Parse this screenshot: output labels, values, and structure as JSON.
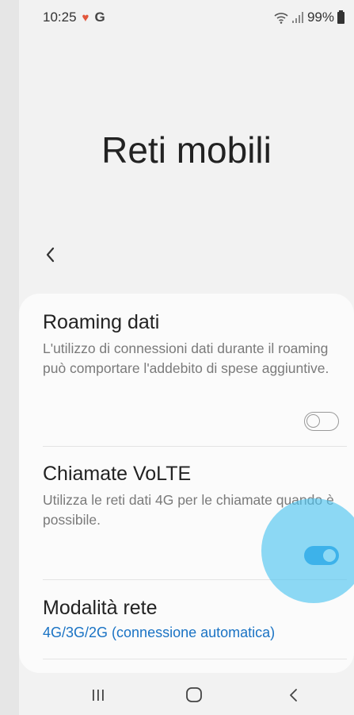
{
  "status_bar": {
    "time": "10:25",
    "battery": "99%",
    "icons": [
      "heart-notification-icon",
      "google-icon",
      "wifi-icon",
      "signal-icon",
      "battery-icon"
    ]
  },
  "header": {
    "title": "Reti mobili",
    "back_icon": "chevron-left-icon"
  },
  "settings": {
    "roaming": {
      "title": "Roaming dati",
      "description": "L'utilizzo di connessioni dati durante il roaming può comportare l'addebito di spese aggiuntive.",
      "enabled": false
    },
    "volte": {
      "title": "Chiamate VoLTE",
      "description": "Utilizza le reti dati 4G per le chiamate quando è possibile.",
      "enabled": true
    },
    "network_mode": {
      "title": "Modalità rete",
      "value": "4G/3G/2G (connessione automatica)"
    }
  },
  "colors": {
    "accent": "#1a8fe0",
    "link": "#1a73c4",
    "touch_indicator": "#50c4f0"
  },
  "nav_bar": {
    "icons": [
      "recents-icon",
      "home-icon",
      "back-icon"
    ]
  }
}
